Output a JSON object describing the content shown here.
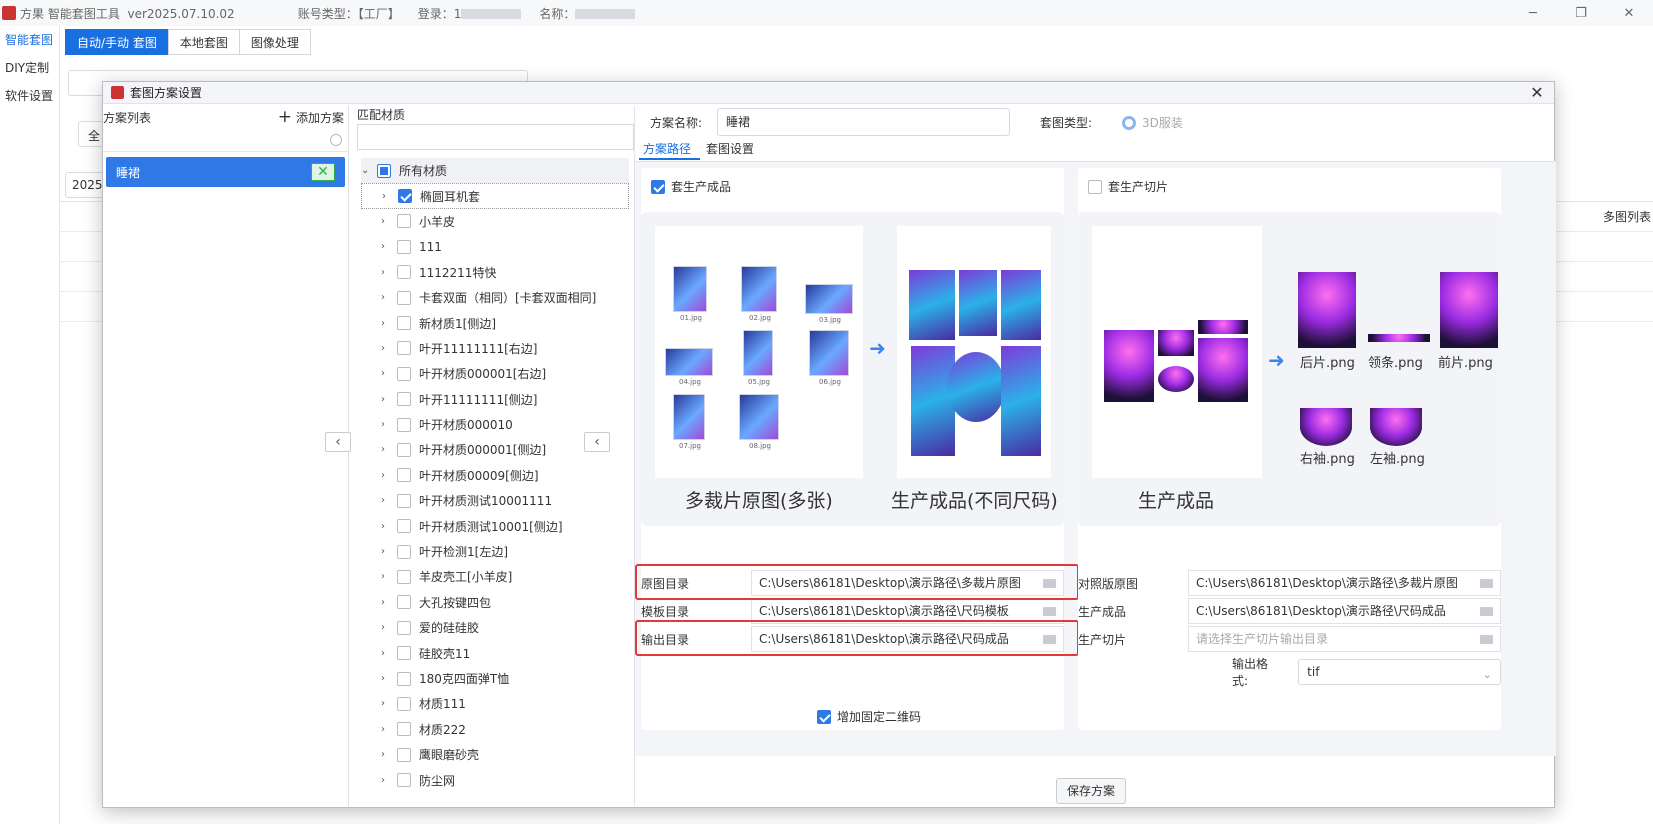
{
  "app": {
    "title": "方果 智能套图工具",
    "version": "ver2025.07.10.02",
    "account_type_label": "账号类型：【工厂】",
    "login_label": "登录：1",
    "name_label": "名称："
  },
  "leftnav": [
    "智能套图",
    "DIY定制",
    "软件设置"
  ],
  "main_tabs": [
    "自动/手动 套图",
    "本地套图",
    "图像处理"
  ],
  "bg": {
    "year_text": "2025",
    "all_text": "全",
    "multi_col": "多图列表"
  },
  "dialog": {
    "title": "套图方案设置",
    "scheme_list_label": "方案列表",
    "add_scheme_label": "添加方案",
    "scheme_items": [
      {
        "name": "睡裙"
      }
    ],
    "match_material_label": "匹配材质",
    "tree_root": "所有材质",
    "materials": [
      {
        "name": "椭圆耳机套",
        "checked": true
      },
      {
        "name": "小羊皮",
        "checked": false
      },
      {
        "name": "111",
        "checked": false
      },
      {
        "name": "1112211特快",
        "checked": false
      },
      {
        "name": "卡套双面（相同）[卡套双面相同]",
        "checked": false
      },
      {
        "name": "新材质1[侧边]",
        "checked": false
      },
      {
        "name": "叶开11111111[右边]",
        "checked": false
      },
      {
        "name": "叶开材质000001[右边]",
        "checked": false
      },
      {
        "name": "叶开11111111[侧边]",
        "checked": false
      },
      {
        "name": "叶开材质000010",
        "checked": false
      },
      {
        "name": "叶开材质000001[侧边]",
        "checked": false
      },
      {
        "name": "叶开材质00009[侧边]",
        "checked": false
      },
      {
        "name": "叶开材质测试10001111",
        "checked": false
      },
      {
        "name": "叶开材质测试10001[侧边]",
        "checked": false
      },
      {
        "name": "叶开检测1[左边]",
        "checked": false
      },
      {
        "name": "羊皮壳工[小羊皮]",
        "checked": false
      },
      {
        "name": "大孔按键四包",
        "checked": false
      },
      {
        "name": "爱的硅硅胶",
        "checked": false
      },
      {
        "name": "硅胶壳11",
        "checked": false
      },
      {
        "name": "180克四面弹T恤",
        "checked": false
      },
      {
        "name": "材质111",
        "checked": false
      },
      {
        "name": "材质222",
        "checked": false
      },
      {
        "name": "鹰眼磨砂壳",
        "checked": false
      },
      {
        "name": "防尘网",
        "checked": false
      }
    ],
    "scheme_name_label": "方案名称:",
    "scheme_name_value": "睡裙",
    "type_label": "套图类型:",
    "type_option": "3D服装",
    "subtabs": [
      "方案路径",
      "套图设置"
    ],
    "left_panel": {
      "checkbox_label": "套生产成品",
      "caption_left": "多裁片原图(多张)",
      "caption_right": "生产成品(不同尺码)",
      "thumb_names": [
        "01.jpg",
        "02.jpg",
        "03.jpg",
        "04.jpg",
        "05.jpg",
        "06.jpg",
        "07.jpg",
        "08.jpg"
      ],
      "paths": [
        {
          "label": "原图目录",
          "value": "C:\\Users\\86181\\Desktop\\演示路径\\多裁片原图"
        },
        {
          "label": "模板目录",
          "value": "C:\\Users\\86181\\Desktop\\演示路径\\尺码模板"
        },
        {
          "label": "输出目录",
          "value": "C:\\Users\\86181\\Desktop\\演示路径\\尺码成品"
        }
      ],
      "qr_label": "增加固定二维码"
    },
    "right_panel": {
      "checkbox_label": "套生产切片",
      "caption": "生产成品",
      "png_names": [
        "后片.png",
        "领条.png",
        "前片.png",
        "右袖.png",
        "左袖.png"
      ],
      "paths": [
        {
          "label": "对照版原图",
          "value": "C:\\Users\\86181\\Desktop\\演示路径\\多裁片原图"
        },
        {
          "label": "生产成品",
          "value": "C:\\Users\\86181\\Desktop\\演示路径\\尺码成品"
        },
        {
          "label": "生产切片",
          "value": "",
          "placeholder": "请选择生产切片输出目录"
        }
      ],
      "format_label": "输出格式:",
      "format_value": "tif"
    },
    "save_label": "保存方案"
  }
}
